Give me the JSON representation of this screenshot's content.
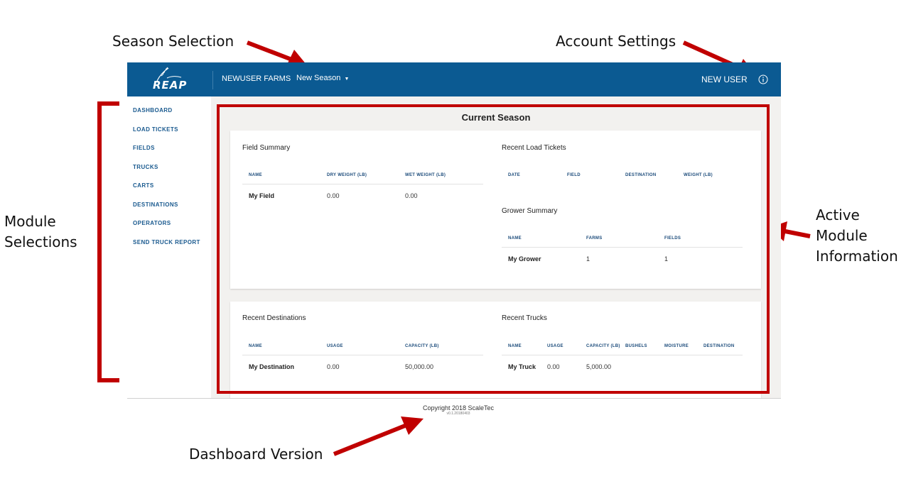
{
  "annotations": {
    "season_selection": "Season Selection",
    "account_settings": "Account Settings",
    "module_selections": [
      "Module",
      "Selections"
    ],
    "active_module_info": [
      "Active",
      "Module",
      "Information"
    ],
    "dashboard_version": "Dashboard Version"
  },
  "header": {
    "logo_text": "REAP",
    "farm_name": "NEWUSER FARMS",
    "season": "New Season",
    "user": "NEW USER",
    "account_icon": "info-circle-icon"
  },
  "sidebar": {
    "items": [
      {
        "label": "DASHBOARD"
      },
      {
        "label": "LOAD TICKETS"
      },
      {
        "label": "FIELDS"
      },
      {
        "label": "TRUCKS"
      },
      {
        "label": "CARTS"
      },
      {
        "label": "DESTINATIONS"
      },
      {
        "label": "OPERATORS"
      },
      {
        "label": "SEND TRUCK REPORT"
      }
    ]
  },
  "main": {
    "title": "Current Season",
    "field_summary": {
      "title": "Field Summary",
      "columns": [
        "NAME",
        "DRY WEIGHT (LB)",
        "WET WEIGHT (LB)"
      ],
      "rows": [
        [
          "My Field",
          "0.00",
          "0.00"
        ]
      ]
    },
    "recent_load_tickets": {
      "title": "Recent Load Tickets",
      "columns": [
        "DATE",
        "FIELD",
        "DESTINATION",
        "WEIGHT (LB)"
      ]
    },
    "grower_summary": {
      "title": "Grower Summary",
      "columns": [
        "NAME",
        "FARMS",
        "FIELDS"
      ],
      "rows": [
        [
          "My Grower",
          "1",
          "1"
        ]
      ]
    },
    "recent_destinations": {
      "title": "Recent Destinations",
      "columns": [
        "NAME",
        "USAGE",
        "CAPACITY (LB)"
      ],
      "rows": [
        [
          "My Destination",
          "0.00",
          "50,000.00"
        ]
      ]
    },
    "recent_trucks": {
      "title": "Recent Trucks",
      "columns": [
        "NAME",
        "USAGE",
        "CAPACITY (LB)",
        "BUSHELS",
        "MOISTURE",
        "DESTINATION"
      ],
      "rows": [
        [
          "My Truck",
          "0.00",
          "5,000.00"
        ]
      ]
    }
  },
  "footer": {
    "copyright": "Copyright 2018 ScaleTec",
    "version": "v0.1.20180403"
  },
  "colors": {
    "header_bg": "#0b5a92",
    "nav_text": "#1a5a8f",
    "annotation_red": "#c00000",
    "content_bg": "#f2f1ef"
  }
}
